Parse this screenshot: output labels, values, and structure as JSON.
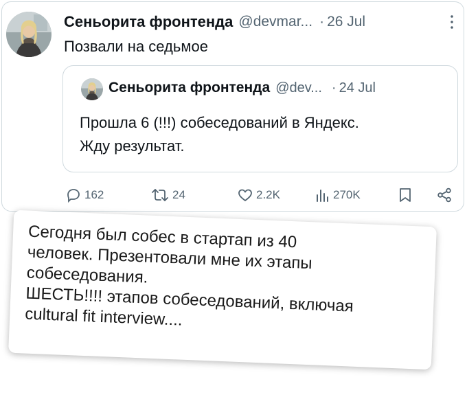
{
  "tweet": {
    "author_name": "Сеньорита фронтенда",
    "author_handle": "@devmar...",
    "separator": "·",
    "date": "26 Jul",
    "text": "Позвали на седьмое",
    "quote": {
      "author_name": "Сеньорита фронтенда",
      "author_handle": "@dev...",
      "separator": "·",
      "date": "24 Jul",
      "text_lines": [
        "Прошла 6 (!!!) собеседований в Яндекс.",
        "Жду результат."
      ]
    },
    "actions": {
      "replies": "162",
      "reposts": "24",
      "likes": "2.2K",
      "views": "270K"
    }
  },
  "note": {
    "lines": [
      "Сегодня был собес в стартап из 40",
      "человек. Презентовали мне их этапы",
      "собеседования.",
      "ШЕСТЬ!!!! этапов собеседований, включая",
      "cultural fit interview...."
    ]
  },
  "icons": {
    "more": "more-vertical-icon",
    "reply": "comment-bubble-icon",
    "repost": "repost-arrows-icon",
    "like": "heart-icon",
    "views": "bar-chart-icon",
    "bookmark": "bookmark-icon",
    "share": "share-icon"
  },
  "colors": {
    "text": "#0f1419",
    "secondary": "#536471",
    "border": "#cfd9de"
  }
}
